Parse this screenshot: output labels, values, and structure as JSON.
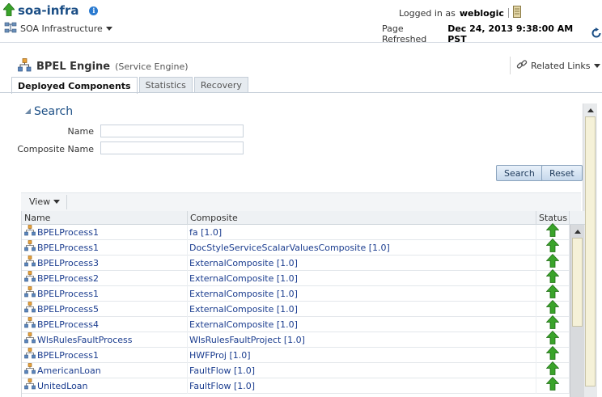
{
  "header": {
    "app_title": "soa-infra",
    "nav_menu_label": "SOA Infrastructure",
    "logged_in_prefix": "Logged in as",
    "username": "weblogic",
    "refresh_prefix": "Page Refreshed",
    "refresh_time": "Dec 24, 2013 9:38:00 AM PST"
  },
  "engine": {
    "title": "BPEL Engine",
    "subtitle": "(Service Engine)",
    "related_links": "Related Links"
  },
  "tabs": [
    {
      "label": "Deployed Components",
      "active": true
    },
    {
      "label": "Statistics",
      "active": false
    },
    {
      "label": "Recovery",
      "active": false
    }
  ],
  "search": {
    "title": "Search",
    "name_label": "Name",
    "name_value": "",
    "composite_label": "Composite Name",
    "composite_value": "",
    "search_button": "Search",
    "reset_button": "Reset"
  },
  "toolbar": {
    "view_label": "View"
  },
  "table": {
    "headers": {
      "name": "Name",
      "composite": "Composite",
      "status": "Status"
    },
    "rows": [
      {
        "name": "BPELProcess1",
        "composite": "fa [1.0]",
        "status": "up"
      },
      {
        "name": "BPELProcess1",
        "composite": "DocStyleServiceScalarValuesComposite [1.0]",
        "status": "up"
      },
      {
        "name": "BPELProcess3",
        "composite": "ExternalComposite [1.0]",
        "status": "up"
      },
      {
        "name": "BPELProcess2",
        "composite": "ExternalComposite [1.0]",
        "status": "up"
      },
      {
        "name": "BPELProcess1",
        "composite": "ExternalComposite [1.0]",
        "status": "up"
      },
      {
        "name": "BPELProcess5",
        "composite": "ExternalComposite [1.0]",
        "status": "up"
      },
      {
        "name": "BPELProcess4",
        "composite": "ExternalComposite [1.0]",
        "status": "up"
      },
      {
        "name": "WlsRulesFaultProcess",
        "composite": "WlsRulesFaultProject [1.0]",
        "status": "up"
      },
      {
        "name": "BPELProcess1",
        "composite": "HWFProj [1.0]",
        "status": "up"
      },
      {
        "name": "AmericanLoan",
        "composite": "FaultFlow [1.0]",
        "status": "up"
      },
      {
        "name": "UnitedLoan",
        "composite": "FaultFlow [1.0]",
        "status": "up"
      }
    ]
  },
  "colors": {
    "link": "#1b3d8f",
    "status_up": "#2f9a1e",
    "title_blue": "#1c4f86"
  }
}
